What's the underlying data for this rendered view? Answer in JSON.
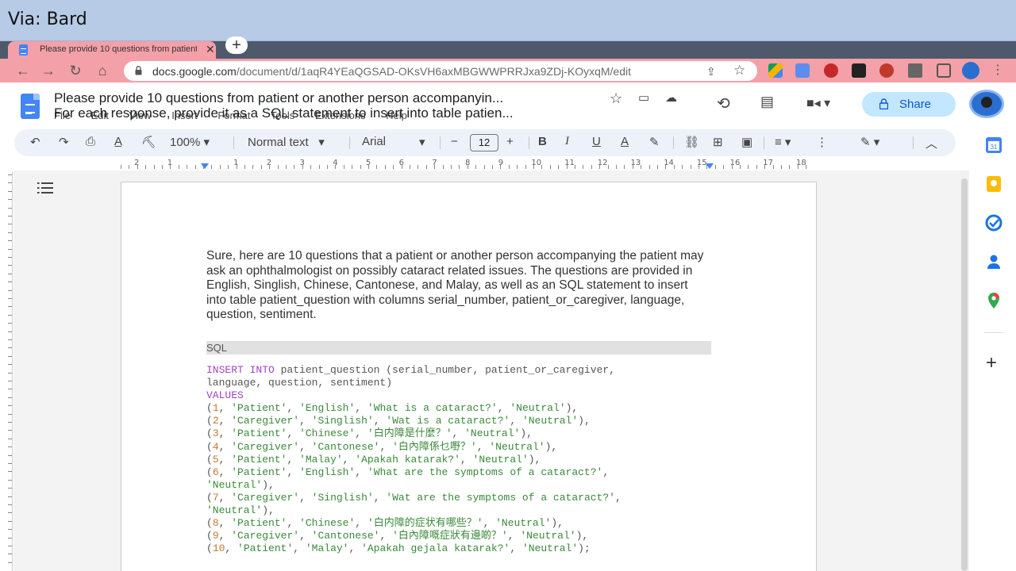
{
  "caption": {
    "text": "Via: Bard"
  },
  "browser": {
    "tab_title": "Please provide 10 questions from patient",
    "tab_close": "✕",
    "new_tab": "+",
    "url_host": "docs.google.com",
    "url_path": "/document/d/1aqR4YEaQGSAD-OKsVH6axMBGWWPRRJxa9ZDj-KOyxqM/edit"
  },
  "doc": {
    "title": "Please provide 10 questions from patient or another person accompanyin...",
    "title_line2": "For each response, provide it as a SQL statement to insert into table patien...",
    "menu": [
      "File",
      "Edit",
      "View",
      "Insert",
      "Format",
      "Tools",
      "Extensions",
      "Help"
    ],
    "share_label": "Share"
  },
  "toolbar": {
    "zoom": "100%",
    "style": "Normal text",
    "font": "Arial",
    "font_size": "12",
    "minus": "−",
    "plus": "+"
  },
  "ruler": {
    "numbers": [
      "2",
      "1",
      "1",
      "2",
      "3",
      "4",
      "5",
      "6",
      "7",
      "8",
      "9",
      "10",
      "11",
      "12",
      "13",
      "14",
      "15",
      "16",
      "17",
      "18"
    ]
  },
  "content": {
    "intro": "Sure, here are 10 questions that a patient or another person accompanying the patient may ask an ophthalmologist on possibly cataract related issues. The questions are provided in English, Singlish, Chinese, Cantonese, and Malay, as well as an SQL statement to insert into table patient_question with columns serial_number, patient_or_caregiver, language, question, sentiment.",
    "code_label": "SQL",
    "sql_keyword1": "INSERT INTO",
    "sql_head1": " patient_question (serial_number, patient_or_caregiver,",
    "sql_head2": "language, question, sentiment)",
    "sql_keyword2": "VALUES",
    "rows": [
      {
        "n": "1",
        "who": "'Patient'",
        "lang": "'English'",
        "q": "'What is a cataract?'",
        "s": "'Neutral'",
        "end": "),",
        "wrap": false
      },
      {
        "n": "2",
        "who": "'Caregiver'",
        "lang": "'Singlish'",
        "q": "'Wat is a cataract?'",
        "s": "'Neutral'",
        "end": "),",
        "wrap": false
      },
      {
        "n": "3",
        "who": "'Patient'",
        "lang": "'Chinese'",
        "q": "'白内障是什麼？'",
        "s": "'Neutral'",
        "end": "),",
        "wrap": false
      },
      {
        "n": "4",
        "who": "'Caregiver'",
        "lang": "'Cantonese'",
        "q": "'白內障係乜嘢？'",
        "s": "'Neutral'",
        "end": "),",
        "wrap": false
      },
      {
        "n": "5",
        "who": "'Patient'",
        "lang": "'Malay'",
        "q": "'Apakah katarak?'",
        "s": "'Neutral'",
        "end": "),",
        "wrap": false
      },
      {
        "n": "6",
        "who": "'Patient'",
        "lang": "'English'",
        "q": "'What are the symptoms of a cataract?'",
        "s": "'Neutral'",
        "end": "),",
        "wrap": true
      },
      {
        "n": "7",
        "who": "'Caregiver'",
        "lang": "'Singlish'",
        "q": "'Wat are the symptoms of a cataract?'",
        "s": "'Neutral'",
        "end": "),",
        "wrap": true
      },
      {
        "n": "8",
        "who": "'Patient'",
        "lang": "'Chinese'",
        "q": "'白内障的症状有哪些？'",
        "s": "'Neutral'",
        "end": "),",
        "wrap": false
      },
      {
        "n": "9",
        "who": "'Caregiver'",
        "lang": "'Cantonese'",
        "q": "'白內障嘅症狀有邊啲？'",
        "s": "'Neutral'",
        "end": "),",
        "wrap": false
      },
      {
        "n": "10",
        "who": "'Patient'",
        "lang": "'Malay'",
        "q": "'Apakah gejala katarak?'",
        "s": "'Neutral'",
        "end": ");",
        "wrap": false
      }
    ]
  },
  "colors": {
    "keyword": "#a043c8",
    "number": "#c47a30",
    "string": "#3a8a3a",
    "accent": "#4285f4",
    "share_bg": "#c2e7ff"
  },
  "icons": [
    "back-arrow-icon",
    "forward-arrow-icon",
    "reload-icon",
    "home-icon",
    "lock-icon",
    "share-page-icon",
    "bookmark-star-icon",
    "star-icon",
    "move-folder-icon",
    "cloud-status-icon",
    "history-icon",
    "comment-icon",
    "meet-camera-icon",
    "undo-icon",
    "redo-icon",
    "print-icon",
    "spellcheck-icon",
    "paint-format-icon",
    "bold-icon",
    "italic-icon",
    "underline-icon",
    "text-color-icon",
    "highlight-icon",
    "link-icon",
    "add-comment-icon",
    "image-icon",
    "align-icon",
    "more-icon",
    "edit-mode-icon",
    "collapse-icon",
    "outline-icon",
    "calendar-icon",
    "keep-icon",
    "tasks-icon",
    "contacts-icon",
    "maps-icon",
    "add-icon"
  ]
}
